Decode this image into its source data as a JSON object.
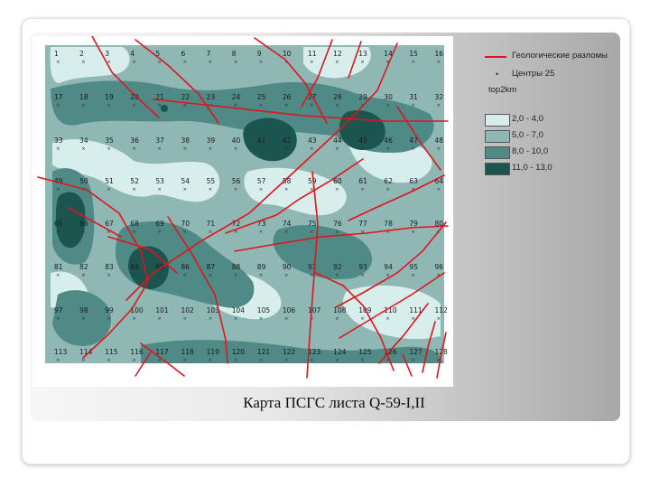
{
  "caption": "Карта ПСГС листа Q-59-I,II",
  "legend": {
    "faults_label": "Геологические разломы",
    "centers_label": "Центры 25",
    "grid_label": "top2km",
    "classes": [
      {
        "range": "2,0 - 4,0",
        "color": "#d8eeec"
      },
      {
        "range": "5,0 - 7,0",
        "color": "#8fb8b4"
      },
      {
        "range": "8,0 - 10,0",
        "color": "#4f8a86"
      },
      {
        "range": "11,0 - 13,0",
        "color": "#1c554f"
      }
    ]
  },
  "map": {
    "colors": {
      "background": "#8fb8b4",
      "light": "#d8eeec",
      "dark": "#4f8a86",
      "darkest": "#1c554f",
      "fault": "#e0141c"
    },
    "grid_rows": [
      [
        "1",
        "2",
        "3",
        "4",
        "5",
        "6",
        "7",
        "8",
        "9",
        "10",
        "11",
        "12",
        "13",
        "14",
        "15",
        "16"
      ],
      [
        "17",
        "18",
        "19",
        "20",
        "21",
        "22",
        "23",
        "24",
        "25",
        "26",
        "27",
        "28",
        "29",
        "30",
        "31",
        "32"
      ],
      [
        "33",
        "34",
        "35",
        "36",
        "37",
        "38",
        "39",
        "40",
        "41",
        "42",
        "43",
        "44",
        "45",
        "46",
        "47",
        "48"
      ],
      [
        "49",
        "50",
        "51",
        "52",
        "53",
        "54",
        "55",
        "56",
        "57",
        "58",
        "59",
        "60",
        "61",
        "62",
        "63",
        "64"
      ],
      [
        "65",
        "66",
        "67",
        "68",
        "69",
        "70",
        "71",
        "72",
        "73",
        "74",
        "75",
        "76",
        "77",
        "78",
        "79",
        "80"
      ],
      [
        "81",
        "82",
        "83",
        "84",
        "85",
        "86",
        "87",
        "88",
        "89",
        "90",
        "91",
        "92",
        "93",
        "94",
        "95",
        "96"
      ],
      [
        "97",
        "98",
        "99",
        "100",
        "101",
        "102",
        "103",
        "104",
        "105",
        "106",
        "107",
        "108",
        "109",
        "110",
        "111",
        "112"
      ],
      [
        "113",
        "114",
        "115",
        "116",
        "117",
        "118",
        "119",
        "120",
        "121",
        "122",
        "123",
        "124",
        "125",
        "126",
        "127",
        "128"
      ]
    ]
  }
}
